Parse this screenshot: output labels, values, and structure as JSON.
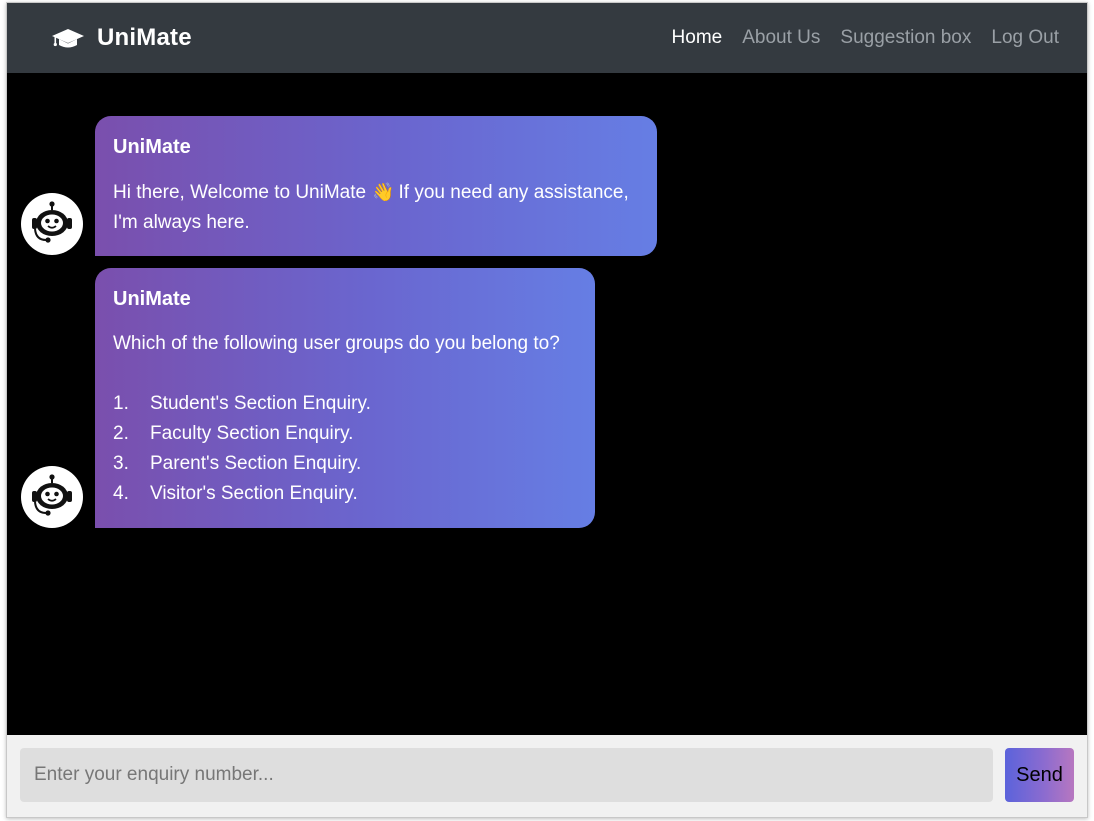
{
  "navbar": {
    "brand": "UniMate",
    "brand_icon": "graduation-cap-icon",
    "links": [
      {
        "label": "Home",
        "active": true
      },
      {
        "label": "About Us",
        "active": false
      },
      {
        "label": "Suggestion box",
        "active": false
      },
      {
        "label": "Log Out",
        "active": false
      }
    ]
  },
  "chat": {
    "messages": [
      {
        "sender": "UniMate",
        "avatar_icon": "robot-icon",
        "text_before_emoji": "Hi there, Welcome to UniMate",
        "emoji": "👋",
        "text_after_emoji": "If you need any assistance, I'm always here."
      },
      {
        "sender": "UniMate",
        "avatar_icon": "robot-icon",
        "text": "Which of the following user groups do you belong to?",
        "options": [
          {
            "num": "1.",
            "label": "Student's Section Enquiry."
          },
          {
            "num": "2.",
            "label": "Faculty Section Enquiry."
          },
          {
            "num": "3.",
            "label": "Parent's Section Enquiry."
          },
          {
            "num": "4.",
            "label": "Visitor's Section Enquiry."
          }
        ]
      }
    ]
  },
  "composer": {
    "placeholder": "Enter your enquiry number...",
    "value": "",
    "send_label": "Send"
  },
  "colors": {
    "navbar_bg": "#343a40",
    "chat_bg": "#000000",
    "bubble_gradient_start": "#7a4fad",
    "bubble_gradient_end": "#667ee4"
  }
}
